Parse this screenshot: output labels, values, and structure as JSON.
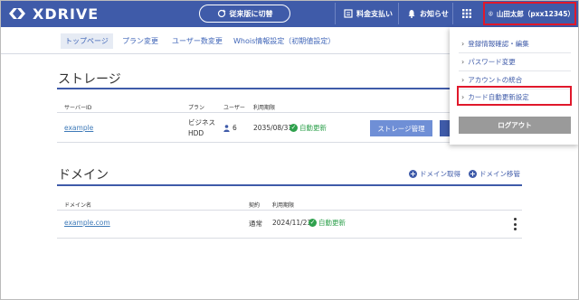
{
  "header": {
    "logo_text": "XDRIVE",
    "switch_label": "従来版に切替",
    "billing_label": "料金支払い",
    "notice_label": "お知らせ",
    "user_label": "山田太郎（pxx12345）"
  },
  "subnav": {
    "items": [
      "トップページ",
      "プラン変更",
      "ユーザー数変更",
      "Whois情報設定（初期値設定）"
    ]
  },
  "storage": {
    "title": "ストレージ",
    "columns": [
      "サーバーID",
      "プラン",
      "ユーザー",
      "利用期限"
    ],
    "row": {
      "server_id": "example",
      "plan_line1": "ビジネス",
      "plan_line2": "HDD",
      "users": "6",
      "expiry": "2035/08/31",
      "renew": "自動更新",
      "manage_button": "ストレージ管理"
    }
  },
  "domain": {
    "title": "ドメイン",
    "acquire_label": "ドメイン取得",
    "transfer_label": "ドメイン移管",
    "columns": [
      "ドメイン名",
      "契約",
      "利用期限"
    ],
    "row": {
      "name": "example.com",
      "contract": "通常",
      "expiry": "2024/11/23",
      "renew": "自動更新"
    }
  },
  "dropdown": {
    "items": [
      "登録情報確認・編集",
      "パスワード変更",
      "アカウントの統合",
      "カード自動更新設定"
    ],
    "logout_label": "ログアウト"
  },
  "colors": {
    "header_bg": "#3f5ba9",
    "highlight": "#e0182b",
    "status_ok": "#2fa14d",
    "link": "#3e7ab8"
  }
}
